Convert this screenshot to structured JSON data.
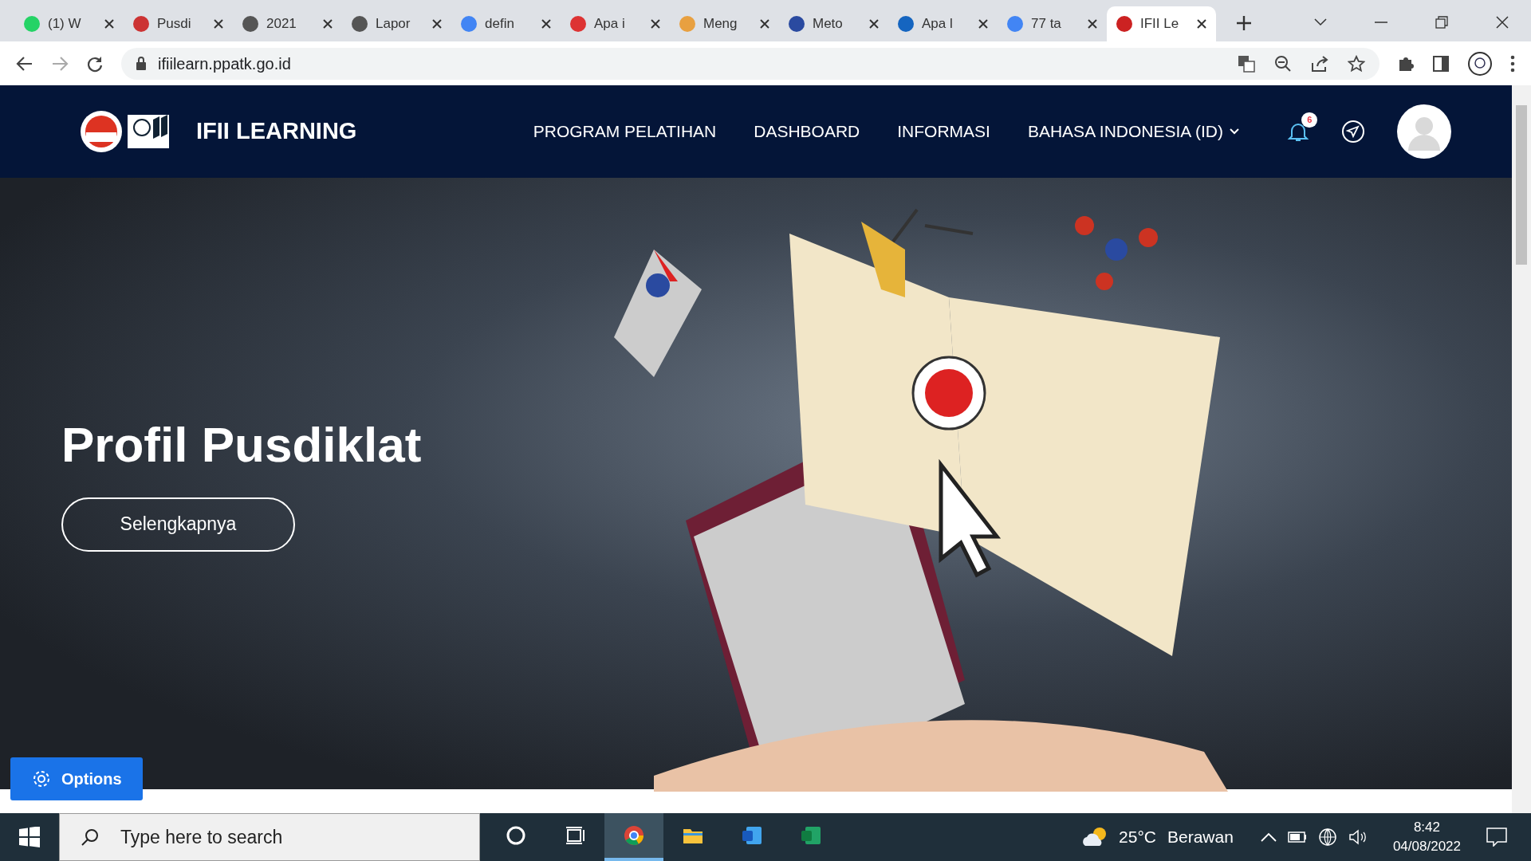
{
  "browser": {
    "tabs": [
      {
        "label": "(1) W",
        "selected": false
      },
      {
        "label": "Pusdi",
        "selected": false
      },
      {
        "label": "2021",
        "selected": false
      },
      {
        "label": "Lapor",
        "selected": false
      },
      {
        "label": "defin",
        "selected": false
      },
      {
        "label": "Apa i",
        "selected": false
      },
      {
        "label": "Meng",
        "selected": false
      },
      {
        "label": "Meto",
        "selected": false
      },
      {
        "label": "Apa l",
        "selected": false
      },
      {
        "label": "77 ta",
        "selected": false
      },
      {
        "label": "IFII Le",
        "selected": true
      }
    ],
    "url": "ifiilearn.ppatk.go.id"
  },
  "site": {
    "brand": "IFII LEARNING",
    "nav": [
      {
        "label": "PROGRAM PELATIHAN",
        "kind": "link"
      },
      {
        "label": "DASHBOARD",
        "kind": "link"
      },
      {
        "label": "INFORMASI",
        "kind": "link"
      },
      {
        "label": "BAHASA INDONESIA (ID)",
        "kind": "dropdown"
      }
    ],
    "notification_count": "6",
    "hero": {
      "title": "Profil Pusdiklat",
      "button": "Selengkapnya"
    },
    "options_button": "Options"
  },
  "taskbar": {
    "search_placeholder": "Type here to search",
    "apps": [
      {
        "kind": "cortana",
        "selected": false
      },
      {
        "kind": "taskview",
        "selected": false
      },
      {
        "kind": "chrome",
        "selected": true
      },
      {
        "kind": "explorer",
        "selected": false
      },
      {
        "kind": "word",
        "selected": false
      },
      {
        "kind": "excel",
        "selected": false
      }
    ],
    "temperature": "25°C",
    "weather": "Berawan",
    "time": "8:42",
    "date": "04/08/2022"
  }
}
